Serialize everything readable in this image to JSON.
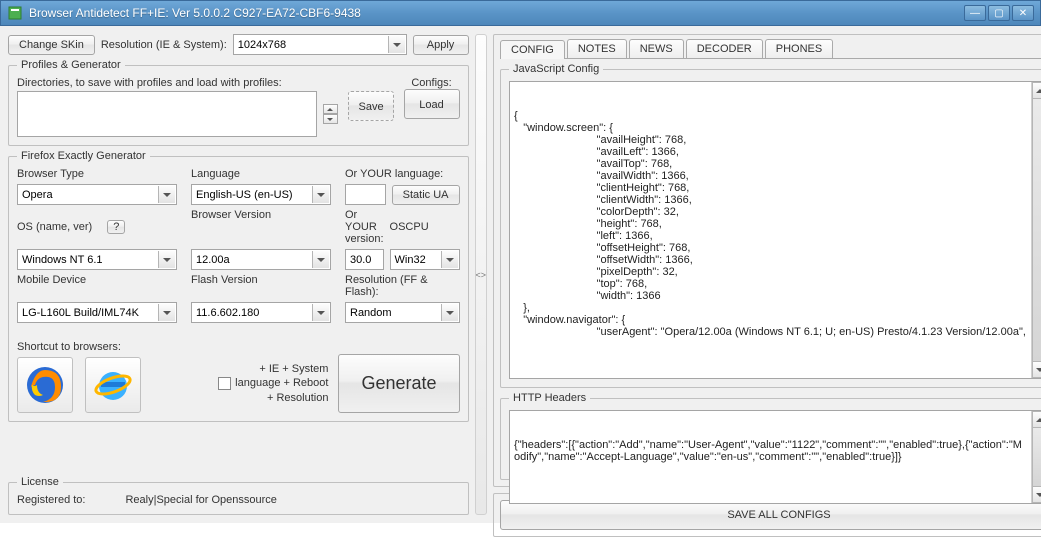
{
  "window": {
    "title": "Browser Antidetect FF+IE:   Ver 5.0.0.2 C927-EA72-CBF6-9438"
  },
  "toolbar": {
    "change_skin": "Change SKin",
    "resolution_label": "Resolution (IE & System):",
    "resolution_value": "1024x768",
    "apply": "Apply"
  },
  "profiles": {
    "legend": "Profiles & Generator",
    "dir_label": "Directories, to save with profiles and load with profiles:",
    "configs_label": "Configs:",
    "save": "Save",
    "load": "Load",
    "dir_value": ""
  },
  "generator": {
    "legend": "Firefox Exactly Generator",
    "browser_type_label": "Browser Type",
    "browser_type_value": "Opera",
    "language_label": "Language",
    "language_value": "English-US (en-US)",
    "or_lang_label": "Or YOUR language:",
    "or_lang_value": "",
    "static_ua": "Static UA",
    "os_label": "OS (name, ver)",
    "os_help": "?",
    "os_value": "Windows NT 6.1",
    "browser_version_label": "Browser Version",
    "browser_version_value": "12.00a",
    "or_version_label": "Or YOUR version:",
    "or_version_value": "30.0",
    "oscpu_label": "OSCPU",
    "oscpu_value": "Win32",
    "mobile_label": "Mobile Device",
    "mobile_value": "LG-L160L Build/IML74K",
    "flash_label": "Flash Version",
    "flash_value": "11.6.602.180",
    "res_ff_label": "Resolution (FF & Flash):",
    "res_ff_value": "Random",
    "shortcut_label": "Shortcut to browsers:",
    "plus_lines": "+ IE + System\nlanguage + Reboot\n+ Resolution",
    "generate": "Generate"
  },
  "license": {
    "legend": "License",
    "registered_label": "Registered to:",
    "registered_value": "Realy|Special for Openssource"
  },
  "tabs": {
    "config": "CONFIG",
    "notes": "NOTES",
    "news": "NEWS",
    "decoder": "DECODER",
    "phones": "PHONES"
  },
  "config_panel": {
    "js_legend": "JavaScript Config",
    "js_text": "{\n   \"window.screen\": {\n                           \"availHeight\": 768,\n                           \"availLeft\": 1366,\n                           \"availTop\": 768,\n                           \"availWidth\": 1366,\n                           \"clientHeight\": 768,\n                           \"clientWidth\": 1366,\n                           \"colorDepth\": 32,\n                           \"height\": 768,\n                           \"left\": 1366,\n                           \"offsetHeight\": 768,\n                           \"offsetWidth\": 1366,\n                           \"pixelDepth\": 32,\n                           \"top\": 768,\n                           \"width\": 1366\n   },\n   \"window.navigator\": {\n                           \"userAgent\": \"Opera/12.00a (Windows NT 6.1; U; en-US) Presto/4.1.23 Version/12.00a\",",
    "http_legend": "HTTP Headers",
    "http_text": "{\"headers\":[{\"action\":\"Add\",\"name\":\"User-Agent\",\"value\":\"1122\",\"comment\":\"\",\"enabled\":true},{\"action\":\"Modify\",\"name\":\"Accept-Language\",\"value\":\"en-us\",\"comment\":\"\",\"enabled\":true}]}",
    "save_all": "SAVE ALL CONFIGS"
  }
}
